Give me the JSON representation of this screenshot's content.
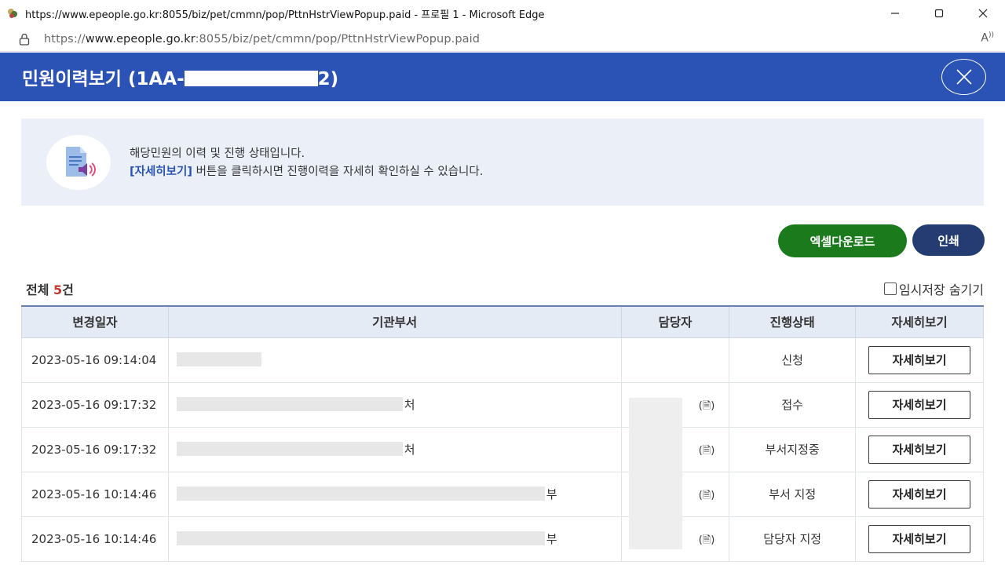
{
  "window": {
    "title": "https://www.epeople.go.kr:8055/biz/pet/cmmn/pop/PttnHstrViewPopup.paid - 프로필 1 - Microsoft Edge"
  },
  "address": {
    "scheme": "https://",
    "host": "www.epeople.go.kr",
    "path": ":8055/biz/pet/cmmn/pop/PttnHstrViewPopup.paid"
  },
  "popup": {
    "title_prefix": "민원이력보기 (1AA-",
    "title_suffix": "2)"
  },
  "info": {
    "line1": "해당민원의 이력 및 진행 상태입니다.",
    "line2_em": "[자세히보기]",
    "line2_rest": " 버튼을 클릭하시면 진행이력을 자세히 확인하실 수 있습니다."
  },
  "actions": {
    "excel": "엑셀다운로드",
    "print": "인쇄"
  },
  "summary": {
    "label": "전체 ",
    "count": "5",
    "unit": "건",
    "hide_temp": "임시저장 숨기기"
  },
  "table": {
    "headers": [
      "변경일자",
      "기관부서",
      "담당자",
      "진행상태",
      "자세히보기"
    ],
    "rows": [
      {
        "date": "2023-05-16 09:14:04",
        "org_suffix": "",
        "mgr_icon": "",
        "status": "신청",
        "detail": "자세히보기"
      },
      {
        "date": "2023-05-16 09:17:32",
        "org_suffix": "처",
        "mgr_icon": "(🗎)",
        "status": "접수",
        "detail": "자세히보기"
      },
      {
        "date": "2023-05-16 09:17:32",
        "org_suffix": "처",
        "mgr_icon": "(🗎)",
        "status": "부서지정중",
        "detail": "자세히보기"
      },
      {
        "date": "2023-05-16 10:14:46",
        "org_suffix": "부",
        "mgr_icon": "(🗎)",
        "status": "부서 지정",
        "detail": "자세히보기"
      },
      {
        "date": "2023-05-16 10:14:46",
        "org_suffix": "부",
        "mgr_icon": "(🗎)",
        "status": "담당자 지정",
        "detail": "자세히보기"
      }
    ]
  },
  "colors": {
    "header_blue": "#2a53b5",
    "excel_green": "#1a7a1c",
    "print_navy": "#253c73",
    "count_red": "#c0392b"
  }
}
